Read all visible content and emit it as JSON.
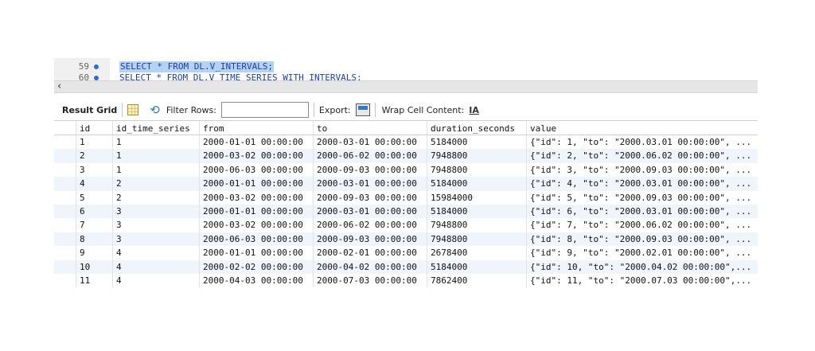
{
  "editor": {
    "lines": [
      {
        "num": "59",
        "sql": "SELECT * FROM DL.V_INTERVALS;"
      },
      {
        "num": "60",
        "sql": "SELECT * FROM DL.V_TIME_SERIES_WITH_INTERVALS;"
      }
    ]
  },
  "toolbar": {
    "result_grid": "Result Grid",
    "filter_rows": "Filter Rows:",
    "filter_value": "",
    "export": "Export:",
    "wrap_cell": "Wrap Cell Content:",
    "wrap_icon_glyph": "IA"
  },
  "grid": {
    "columns": [
      "id",
      "id_time_series",
      "from",
      "to",
      "duration_seconds",
      "value"
    ],
    "rows": [
      [
        "1",
        "1",
        "2000-01-01 00:00:00",
        "2000-03-01 00:00:00",
        "5184000",
        "{\"id\": 1, \"to\": \"2000.03.01 00:00:00\", ..."
      ],
      [
        "2",
        "1",
        "2000-03-02 00:00:00",
        "2000-06-02 00:00:00",
        "7948800",
        "{\"id\": 2, \"to\": \"2000.06.02 00:00:00\", ..."
      ],
      [
        "3",
        "1",
        "2000-06-03 00:00:00",
        "2000-09-03 00:00:00",
        "7948800",
        "{\"id\": 3, \"to\": \"2000.09.03 00:00:00\", ..."
      ],
      [
        "4",
        "2",
        "2000-01-01 00:00:00",
        "2000-03-01 00:00:00",
        "5184000",
        "{\"id\": 4, \"to\": \"2000.03.01 00:00:00\", ..."
      ],
      [
        "5",
        "2",
        "2000-03-02 00:00:00",
        "2000-09-03 00:00:00",
        "15984000",
        "{\"id\": 5, \"to\": \"2000.09.03 00:00:00\", ..."
      ],
      [
        "6",
        "3",
        "2000-01-01 00:00:00",
        "2000-03-01 00:00:00",
        "5184000",
        "{\"id\": 6, \"to\": \"2000.03.01 00:00:00\", ..."
      ],
      [
        "7",
        "3",
        "2000-03-02 00:00:00",
        "2000-06-02 00:00:00",
        "7948800",
        "{\"id\": 7, \"to\": \"2000.06.02 00:00:00\", ..."
      ],
      [
        "8",
        "3",
        "2000-06-03 00:00:00",
        "2000-09-03 00:00:00",
        "7948800",
        "{\"id\": 8, \"to\": \"2000.09.03 00:00:00\", ..."
      ],
      [
        "9",
        "4",
        "2000-01-01 00:00:00",
        "2000-02-01 00:00:00",
        "2678400",
        "{\"id\": 9, \"to\": \"2000.02.01 00:00:00\", ..."
      ],
      [
        "10",
        "4",
        "2000-02-02 00:00:00",
        "2000-04-02 00:00:00",
        "5184000",
        "{\"id\": 10, \"to\": \"2000.04.02 00:00:00\",..."
      ],
      [
        "11",
        "4",
        "2000-04-03 00:00:00",
        "2000-07-03 00:00:00",
        "7862400",
        "{\"id\": 11, \"to\": \"2000.07.03 00:00:00\",..."
      ]
    ]
  }
}
